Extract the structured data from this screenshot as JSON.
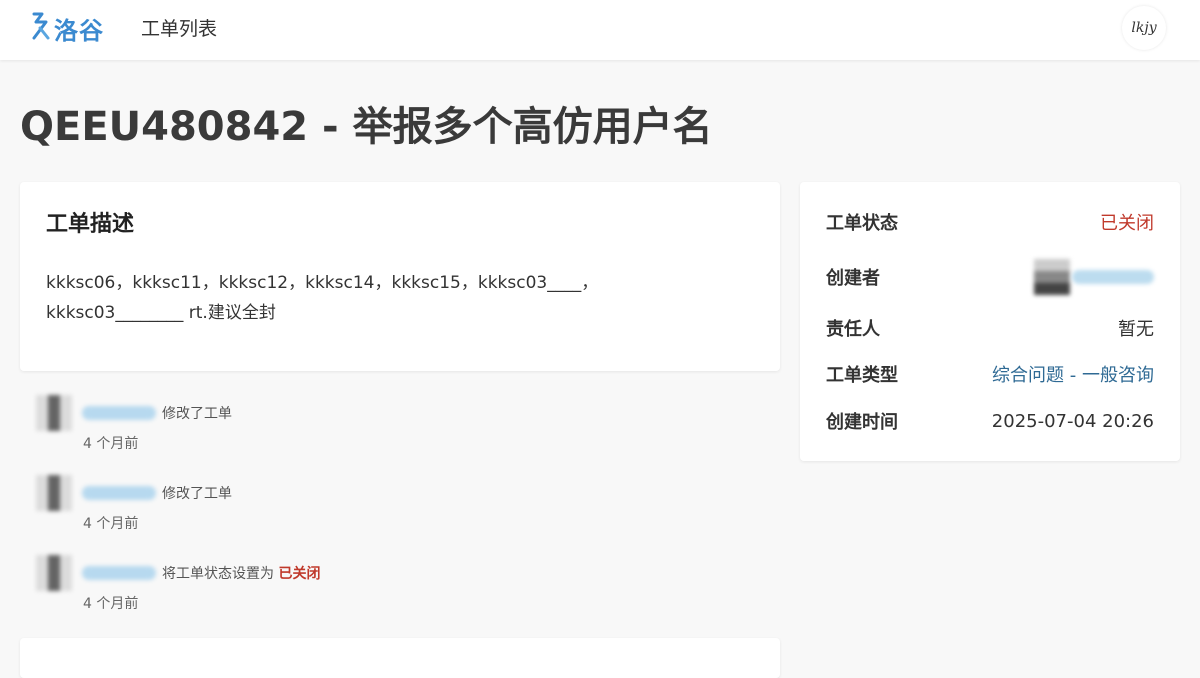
{
  "nav": {
    "logo_text": "洛谷",
    "ticket_list": "工单列表",
    "user_initials": "lkjy"
  },
  "ticket": {
    "title": "QEEU480842 - 举报多个高仿用户名",
    "description_heading": "工单描述",
    "description_line1": "kkksc06，kkksc11，kkksc12，kkksc14，kkksc15，kkksc03____，",
    "description_line2": "kkksc03________ rt.建议全封"
  },
  "info": {
    "status_label": "工单状态",
    "status_value": "已关闭",
    "creator_label": "创建者",
    "assignee_label": "责任人",
    "assignee_value": "暂无",
    "type_label": "工单类型",
    "type_value": "综合问题 - 一般咨询",
    "created_label": "创建时间",
    "created_value": "2025-07-04 20:26"
  },
  "activities": [
    {
      "action": "修改了工单",
      "time": "4 个月前"
    },
    {
      "action": "修改了工单",
      "time": "4 个月前"
    },
    {
      "action": "将工单状态设置为",
      "status": "已关闭",
      "time": "4 个月前"
    }
  ],
  "colors": {
    "accent": "#3b8ad0",
    "closed": "#c0392b",
    "link": "#2f6a94",
    "background": "#f8f8f8"
  },
  "icons": {
    "logo": "luogu-logo-icon"
  }
}
